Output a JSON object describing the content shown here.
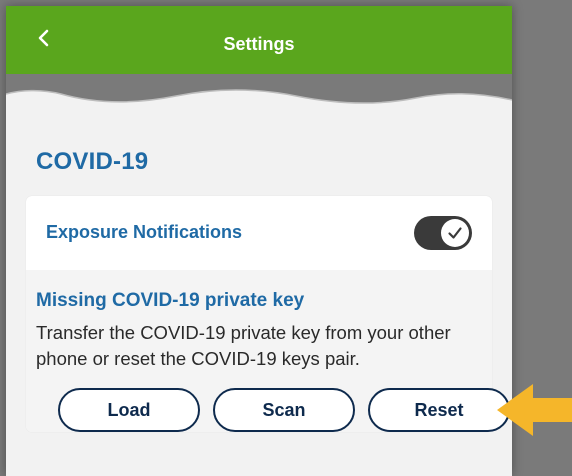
{
  "header": {
    "title": "Settings",
    "back_icon": "chevron-left-icon",
    "color": "#5aa61d"
  },
  "section": {
    "title": "COVID-19"
  },
  "exposure": {
    "label": "Exposure Notifications",
    "enabled": true
  },
  "warning": {
    "title": "Missing COVID-19 private key",
    "text": "Transfer the COVID-19 private key from your other phone or reset the COVID-19 keys pair."
  },
  "buttons": {
    "load": "Load",
    "scan": "Scan",
    "reset": "Reset"
  },
  "annotation": {
    "arrow_icon": "arrow-left-icon",
    "color": "#f5b62a"
  },
  "colors": {
    "accent_blue": "#1f6aa5",
    "button_border": "#0e2a4d",
    "background": "#f2f2f2"
  }
}
